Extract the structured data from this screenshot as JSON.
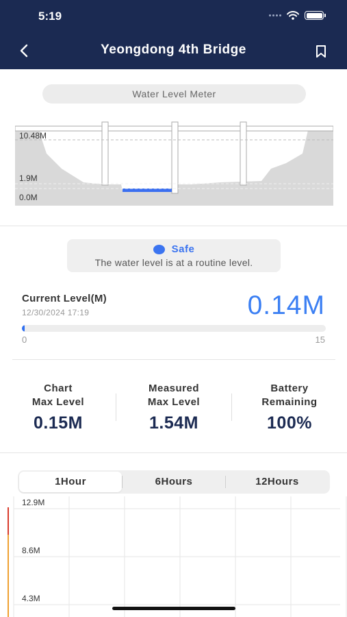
{
  "status_bar": {
    "time": "5:19"
  },
  "nav": {
    "title": "Yeongdong 4th Bridge"
  },
  "meter": {
    "pill_label": "Water Level Meter",
    "levels": {
      "top": "10.48M",
      "warning": "1.9M",
      "base": "0.0M"
    }
  },
  "status": {
    "label": "Safe",
    "message": "The water level is at a routine level.",
    "color": "#3b74f0"
  },
  "current": {
    "label": "Current Level(M)",
    "timestamp": "12/30/2024 17:19",
    "value": "0.14M",
    "progress_value": 0.14,
    "progress_min": "0",
    "progress_max": "15",
    "accent": "#3b7ff3"
  },
  "stats": [
    {
      "label_line1": "Chart",
      "label_line2": "Max Level",
      "value": "0.15M"
    },
    {
      "label_line1": "Measured",
      "label_line2": "Max Level",
      "value": "1.54M"
    },
    {
      "label_line1": "Battery",
      "label_line2": "Remaining",
      "value": "100%"
    }
  ],
  "tabs": [
    {
      "label": "1Hour",
      "active": true
    },
    {
      "label": "6Hours",
      "active": false
    },
    {
      "label": "12Hours",
      "active": false
    }
  ],
  "chart_data": {
    "type": "line",
    "title": "",
    "xlabel": "",
    "ylabel": "",
    "y_tick_labels": [
      "12.9M",
      "8.6M",
      "4.3M"
    ],
    "y_ticks": [
      12.9,
      8.6,
      4.3
    ],
    "grid": true,
    "legend": "none",
    "threshold_colors": [
      "#d93b2b",
      "#f0a030"
    ],
    "series": []
  },
  "colors": {
    "header_bg": "#1b2a52",
    "water": "#3b6ff0",
    "terrain": "#d9d9d9"
  },
  "icons": {
    "back": "chevron-left-icon",
    "bookmark": "bookmark-icon",
    "wifi": "wifi-icon",
    "battery": "battery-icon",
    "signal": "signal-dots-icon"
  }
}
